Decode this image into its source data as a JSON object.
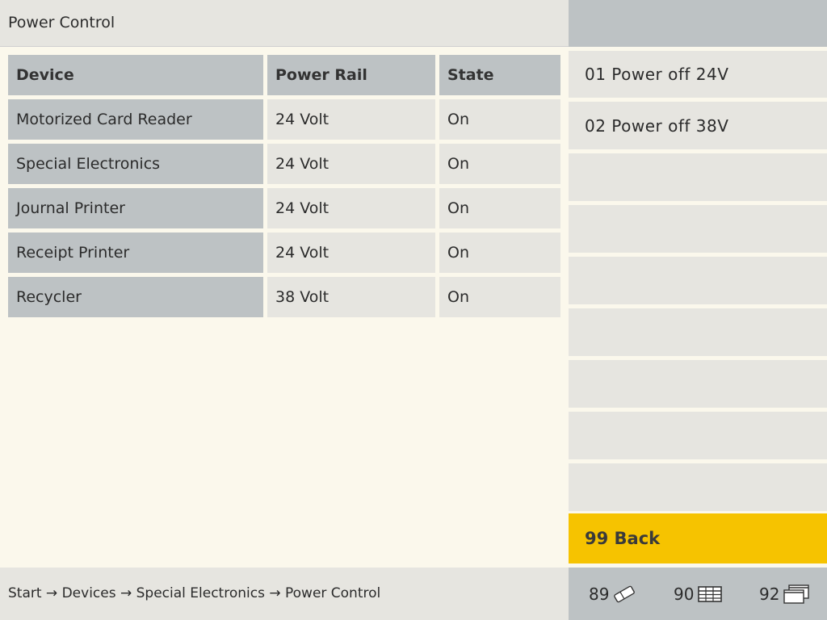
{
  "header": {
    "title": "Power Control"
  },
  "table": {
    "columns": [
      "Device",
      "Power Rail",
      "State"
    ],
    "rows": [
      [
        "Motorized Card Reader",
        "24 Volt",
        "On"
      ],
      [
        "Special Electronics",
        "24 Volt",
        "On"
      ],
      [
        "Journal Printer",
        "24 Volt",
        "On"
      ],
      [
        "Receipt Printer",
        "24 Volt",
        "On"
      ],
      [
        "Recycler",
        "38 Volt",
        "On"
      ]
    ]
  },
  "menu": {
    "items": [
      "01 Power off 24V",
      "02 Power off 38V",
      "",
      "",
      "",
      "",
      "",
      "",
      ""
    ],
    "back": "99 Back",
    "back_color": "#f6c300"
  },
  "footer": {
    "breadcrumb": "Start → Devices → Special Electronics → Power Control",
    "buttons": [
      {
        "num": "89",
        "icon": "eraser-icon"
      },
      {
        "num": "90",
        "icon": "table-grid-icon"
      },
      {
        "num": "92",
        "icon": "windows-icon"
      }
    ]
  }
}
